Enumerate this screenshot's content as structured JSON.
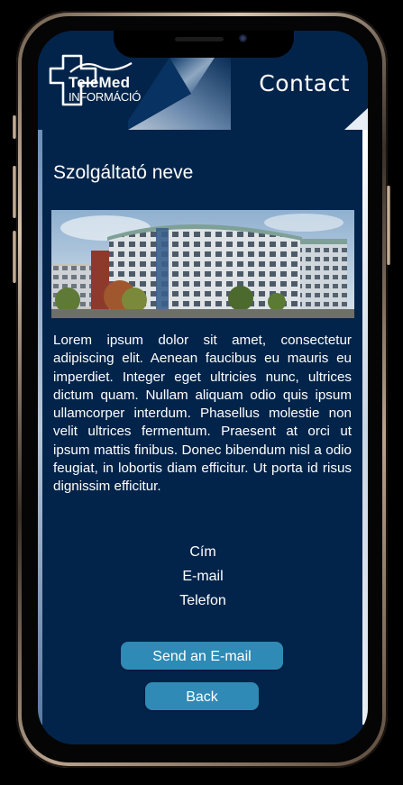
{
  "header": {
    "logo_line1": "TeleMed",
    "logo_line2": "INFORMÁCIÓ",
    "title": "Contact"
  },
  "provider": {
    "name": "Szolgáltató neve",
    "description": "Lorem ipsum dolor sit amet, consectetur adipiscing elit. Aenean faucibus eu mauris eu imperdiet. Integer eget ultricies nunc, ultrices dictum quam. Nullam aliquam odio quis ipsum ullamcorper interdum. Phasellus molestie non velit ultrices fermentum. Praesent at orci ut ipsum mattis finibus. Donec bibendum nisl a odio feugiat, in lobortis diam efficitur. Ut porta id risus dignissim efficitur.",
    "address_label": "Cím",
    "email_label": "E-mail",
    "phone_label": "Telefon"
  },
  "actions": {
    "send_email": "Send an E-mail",
    "back": "Back"
  },
  "colors": {
    "background": "#03244a",
    "button": "#2f8ab5",
    "text": "#ffffff"
  }
}
